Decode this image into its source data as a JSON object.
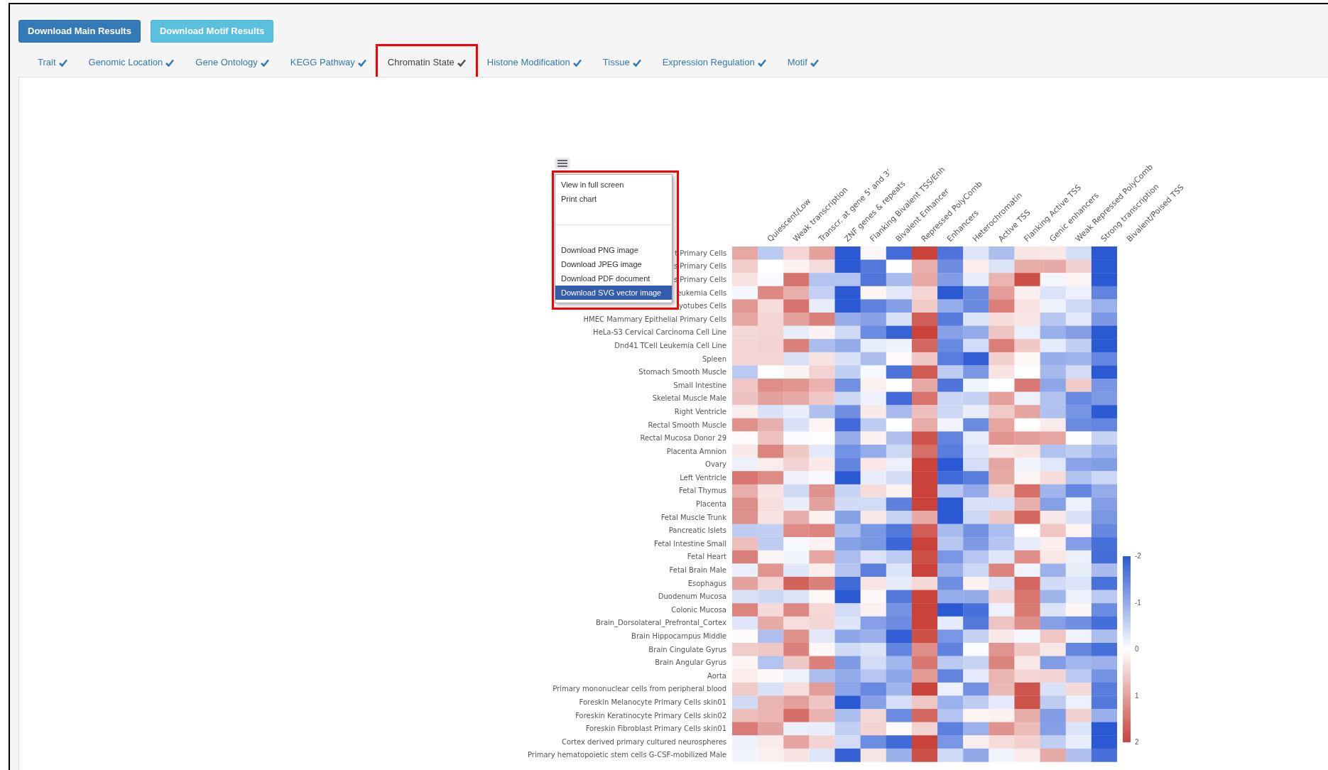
{
  "buttons": [
    {
      "label": "Download Main Results",
      "kind": "primary"
    },
    {
      "label": "Download Motif Results",
      "kind": "info"
    }
  ],
  "tabs": [
    {
      "label": "Trait",
      "selected": false,
      "checked": true,
      "highlighted": false
    },
    {
      "label": "Genomic Location",
      "selected": false,
      "checked": true,
      "highlighted": false
    },
    {
      "label": "Gene Ontology",
      "selected": false,
      "checked": true,
      "highlighted": false
    },
    {
      "label": "KEGG Pathway",
      "selected": false,
      "checked": true,
      "highlighted": false
    },
    {
      "label": "Chromatin State",
      "selected": true,
      "checked": true,
      "highlighted": true
    },
    {
      "label": "Histone Modification",
      "selected": false,
      "checked": true,
      "highlighted": false
    },
    {
      "label": "Tissue",
      "selected": false,
      "checked": true,
      "highlighted": false
    },
    {
      "label": "Expression Regulation",
      "selected": false,
      "checked": true,
      "highlighted": false
    },
    {
      "label": "Motif",
      "selected": false,
      "checked": true,
      "highlighted": false
    }
  ],
  "heatmap": {
    "columns": [
      "Quiescent/Low",
      "Weak transcription",
      "Transcr. at gene 5' and 3'",
      "ZNF genes & repeats",
      "Flanking Bivalent TSS/Enh",
      "Bivalent Enhancer",
      "Repressed PolyComb",
      "Enhancers",
      "Heterochromatin",
      "Active TSS",
      "Flanking Active TSS",
      "Genic enhancers",
      "Weak Repressed PolyComb",
      "Strong transcription",
      "Bivalent/Poised TSS"
    ],
    "rows": [
      "t Primary Cells",
      "s Primary Cells",
      "s Primary Cells",
      "eukemia Cells",
      "yotubes Cells",
      "HMEC Mammary Epithelial Primary Cells",
      "HeLa-S3 Cervical Carcinoma Cell Line",
      "Dnd41 TCell Leukemia Cell Line",
      "Spleen",
      "Stomach Smooth Muscle",
      "Small Intestine",
      "Skeletal Muscle Male",
      "Right Ventricle",
      "Rectal Smooth Muscle",
      "Rectal Mucosa Donor 29",
      "Placenta Amnion",
      "Ovary",
      "Left Ventricle",
      "Fetal Thymus",
      "Placenta",
      "Fetal Muscle Trunk",
      "Pancreatic Islets",
      "Fetal Intestine Small",
      "Fetal Heart",
      "Fetal Brain Male",
      "Esophagus",
      "Duodenum Mucosa",
      "Colonic Mucosa",
      "Brain_Dorsolateral_Prefrontal_Cortex",
      "Brain Hippocampus Middle",
      "Brain Cingulate Gyrus",
      "Brain Angular Gyrus",
      "Aorta",
      "Primary mononuclear cells from peripheral blood",
      "Foreskin Melanocyte Primary Cells skin01",
      "Foreskin Keratinocyte Primary Cells skin02",
      "Foreskin Fibroblast Primary Cells skin01",
      "Cortex derived primary cultured neurospheres",
      "Primary hematopoietic stem cells G-CSF-mobilized Male"
    ],
    "legend_labels": [
      "-2",
      "-1",
      "0",
      "1",
      "2"
    ]
  },
  "menu": {
    "highlighted": true,
    "items": [
      {
        "label": "View in full screen",
        "kind": "item",
        "selected": false
      },
      {
        "label": "Print chart",
        "kind": "item",
        "selected": false
      },
      {
        "kind": "separator"
      },
      {
        "label": "Download PNG image",
        "kind": "item",
        "selected": false
      },
      {
        "label": "Download JPEG image",
        "kind": "item",
        "selected": false
      },
      {
        "label": "Download PDF document",
        "kind": "item",
        "selected": false
      },
      {
        "label": "Download SVG vector image",
        "kind": "item",
        "selected": true
      }
    ]
  }
}
